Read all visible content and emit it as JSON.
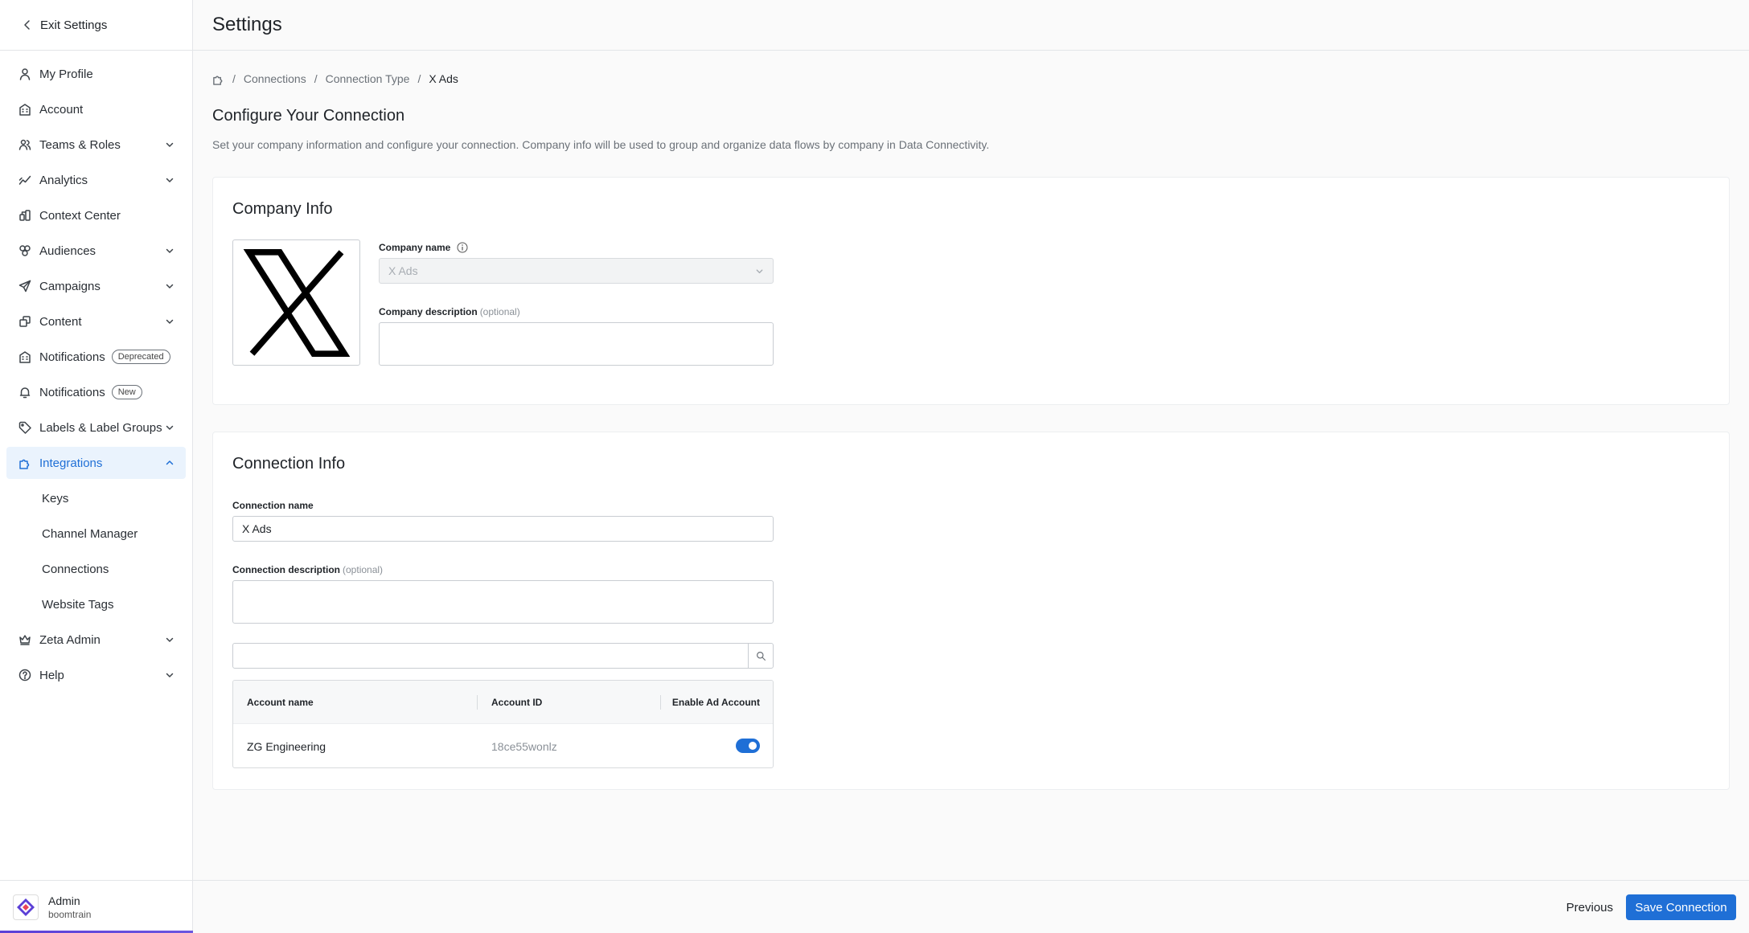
{
  "sidebar": {
    "exit_label": "Exit Settings",
    "items": [
      {
        "label": "My Profile",
        "icon": "user-icon",
        "expandable": false
      },
      {
        "label": "Account",
        "icon": "building-icon",
        "expandable": false
      },
      {
        "label": "Teams & Roles",
        "icon": "team-icon",
        "expandable": true
      },
      {
        "label": "Analytics",
        "icon": "analytics-icon",
        "expandable": true
      },
      {
        "label": "Context Center",
        "icon": "context-icon",
        "expandable": false
      },
      {
        "label": "Audiences",
        "icon": "audiences-icon",
        "expandable": true
      },
      {
        "label": "Campaigns",
        "icon": "send-icon",
        "expandable": true
      },
      {
        "label": "Content",
        "icon": "content-icon",
        "expandable": true
      },
      {
        "label": "Notifications",
        "icon": "building-icon",
        "badge": "Deprecated"
      },
      {
        "label": "Notifications",
        "icon": "bell-icon",
        "badge": "New"
      },
      {
        "label": "Labels & Label Groups",
        "icon": "tag-icon",
        "expandable": true
      },
      {
        "label": "Integrations",
        "icon": "puzzle-icon",
        "expandable": true,
        "active": true
      }
    ],
    "sub_items": [
      "Keys",
      "Channel Manager",
      "Connections",
      "Website Tags"
    ],
    "bottom_items": [
      {
        "label": "Zeta Admin",
        "icon": "crown-icon",
        "expandable": true
      },
      {
        "label": "Help",
        "icon": "help-icon",
        "expandable": true
      }
    ],
    "profile": {
      "name": "Admin",
      "org": "boomtrain"
    }
  },
  "header": {
    "title": "Settings"
  },
  "breadcrumb": {
    "items": [
      "Connections",
      "Connection Type"
    ],
    "current": "X Ads"
  },
  "page": {
    "heading": "Configure Your Connection",
    "subtitle": "Set your company information and configure your connection. Company info will be used to group and organize data flows by company in Data Connectivity."
  },
  "company_info": {
    "title": "Company Info",
    "name_label": "Company name",
    "name_value": "X Ads",
    "description_label": "Company description",
    "optional": "(optional)"
  },
  "connection_info": {
    "title": "Connection Info",
    "name_label": "Connection name",
    "name_value": "X Ads",
    "description_label": "Connection description",
    "optional": "(optional)",
    "table": {
      "headers": [
        "Account name",
        "Account ID",
        "Enable Ad Account"
      ],
      "rows": [
        {
          "name": "ZG Engineering",
          "id": "18ce55wonlz",
          "enabled": true
        }
      ]
    }
  },
  "footer": {
    "previous_label": "Previous",
    "save_label": "Save Connection"
  },
  "colors": {
    "accent": "#1f6fd6",
    "active_bg": "#eaf3fd"
  }
}
